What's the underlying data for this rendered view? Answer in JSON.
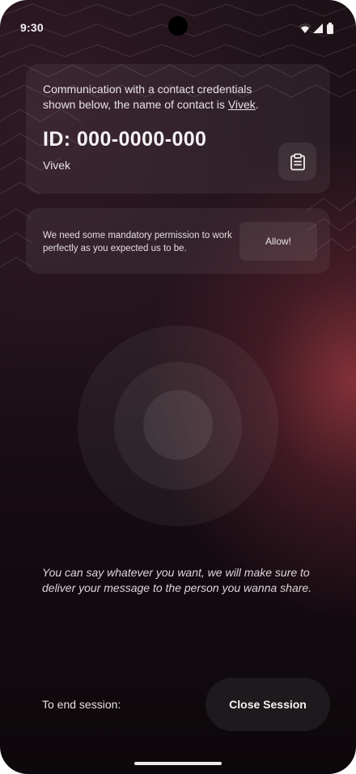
{
  "status_bar": {
    "time": "9:30",
    "icons": [
      "wifi-icon",
      "cellular-signal-icon",
      "battery-icon"
    ]
  },
  "credentials_card": {
    "description_prefix": "Communication with a contact credentials shown below,  the name of contact is ",
    "contact_link": "Vivek",
    "description_suffix": ".",
    "id_text": "ID: 000-0000-000",
    "contact_name": "Vivek",
    "copy_icon": "clipboard-icon"
  },
  "permission_card": {
    "text": "We need some mandatory permission to work perfectly as you expected us to be.",
    "allow_label": "Allow!"
  },
  "hint_text": "You can say whatever you want, we will make sure to deliver your message to the person you wanna share.",
  "footer": {
    "end_label": "To end session:",
    "close_label": "Close Session"
  },
  "colors": {
    "background": "#1b1116",
    "accent_glow": "#96373e",
    "close_button": "#1c1a1c",
    "text": "#e8e2e5"
  }
}
